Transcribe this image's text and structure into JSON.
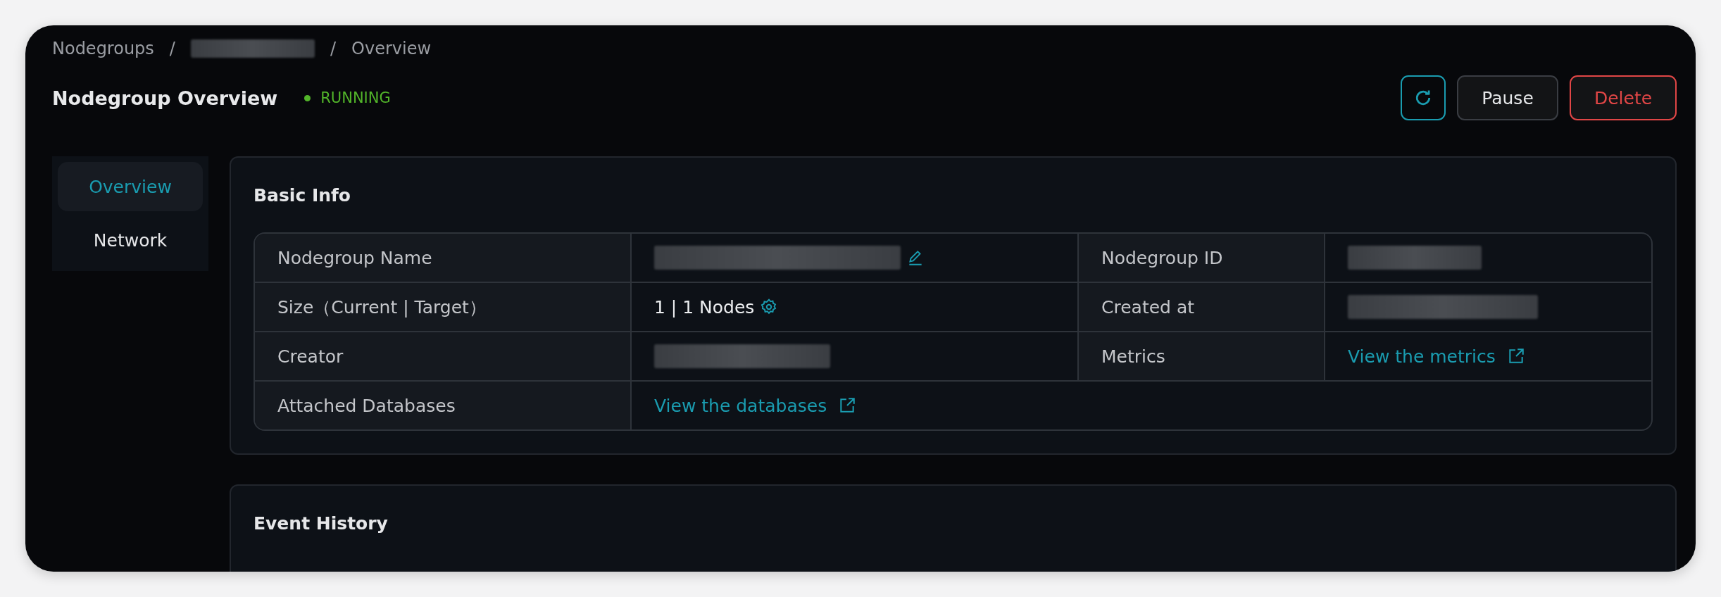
{
  "breadcrumb": [
    {
      "kind": "text",
      "label": "Nodegroups"
    },
    {
      "kind": "separator",
      "label": "/"
    },
    {
      "kind": "redacted"
    },
    {
      "kind": "separator",
      "label": "/"
    },
    {
      "kind": "text",
      "label": "Overview"
    }
  ],
  "header": {
    "title": "Nodegroup Overview",
    "status": {
      "label": "RUNNING",
      "color": "#52b52a"
    }
  },
  "actions": [
    {
      "kind": "refresh"
    },
    {
      "kind": "text",
      "label": "Pause"
    },
    {
      "kind": "danger",
      "label": "Delete"
    }
  ],
  "sidebar": {
    "items": [
      {
        "label": "Overview",
        "selected": true
      },
      {
        "label": "Network",
        "selected": false
      }
    ]
  },
  "basic_info": {
    "title": "Basic Info",
    "rows": [
      {
        "cells": [
          {
            "label": "Nodegroup Name",
            "value": {
              "kind": "editable_redacted"
            }
          },
          {
            "label": "Nodegroup ID",
            "value": {
              "kind": "redacted"
            }
          }
        ]
      },
      {
        "cells": [
          {
            "label": "Size（Current | Target）",
            "value": {
              "kind": "adjustable_text",
              "text": "1 | 1 Nodes"
            }
          },
          {
            "label": "Created at",
            "value": {
              "kind": "redacted"
            }
          }
        ]
      },
      {
        "cells": [
          {
            "label": "Creator",
            "value": {
              "kind": "redacted"
            }
          },
          {
            "label": "Metrics",
            "value": {
              "kind": "link",
              "text": "View the metrics"
            }
          }
        ]
      },
      {
        "cells": [
          {
            "label": "Attached Databases",
            "value": {
              "kind": "link",
              "text": "View the databases"
            }
          }
        ]
      }
    ]
  },
  "event_history": {
    "title": "Event History"
  }
}
